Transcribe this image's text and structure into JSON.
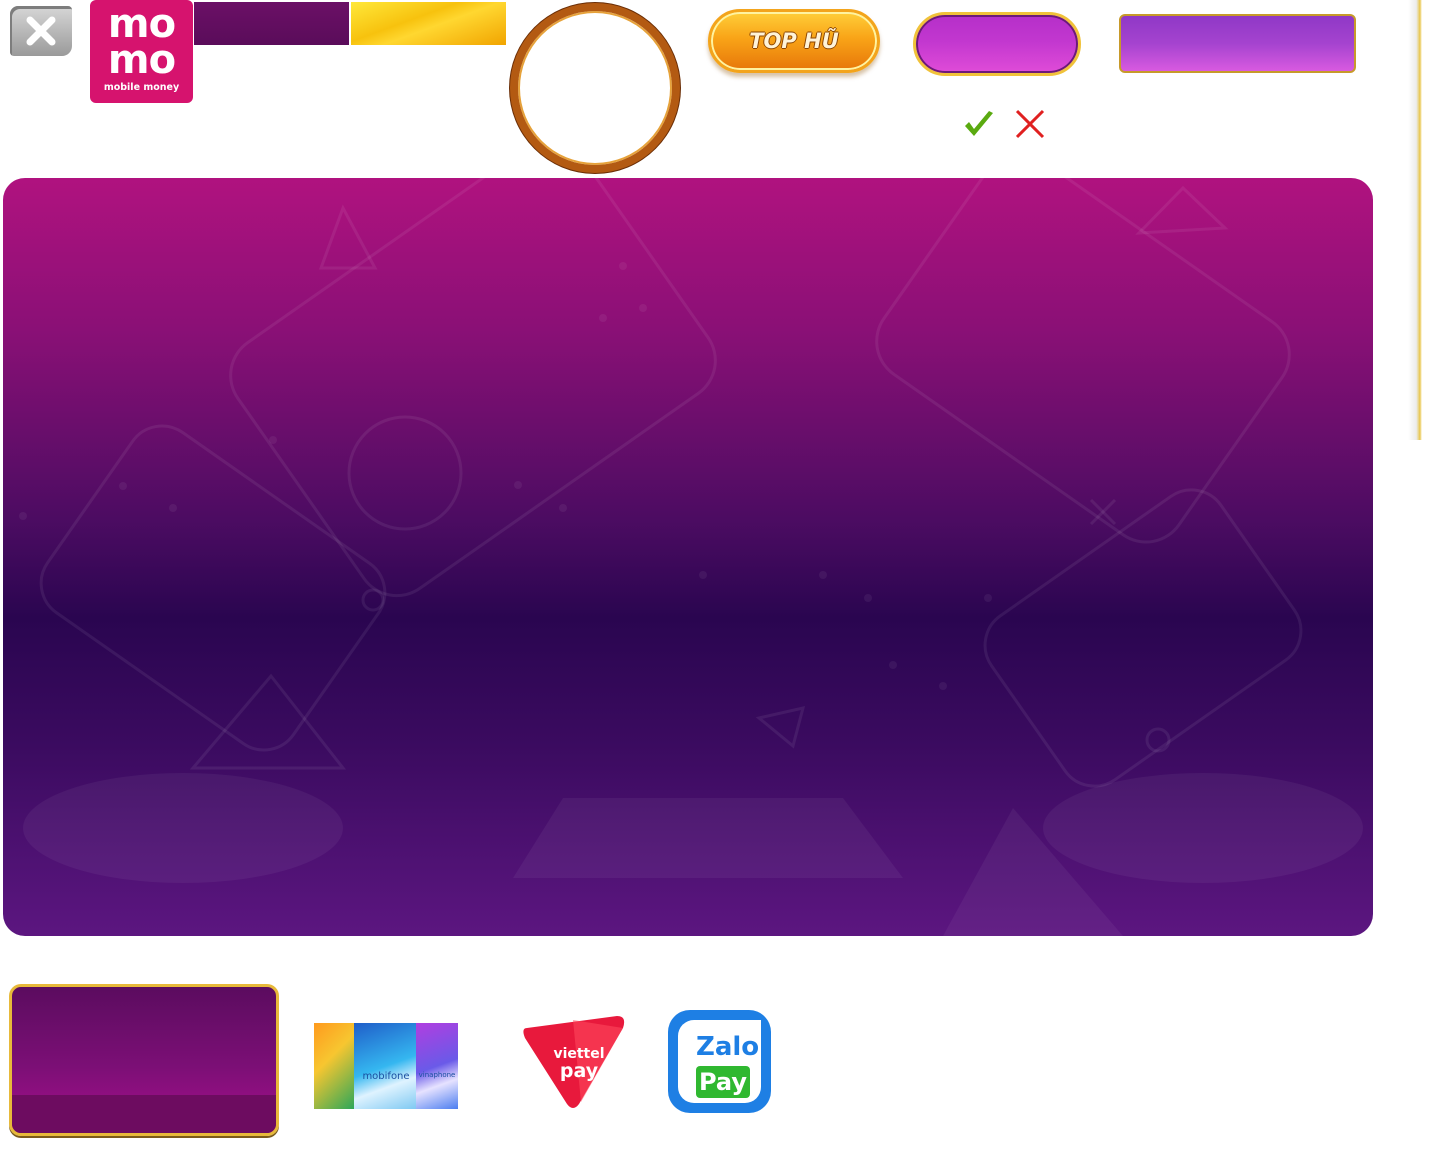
{
  "close_button": {
    "icon": "close-icon"
  },
  "momo_logo": {
    "line1": "mo",
    "line2": "mo",
    "subtitle": "mobile money",
    "color": "#d6136e"
  },
  "top_hu_button": {
    "label": "TOP HŨ"
  },
  "status_icons": {
    "confirm": "check-icon",
    "cancel": "x-icon",
    "confirm_color": "#5aaa10",
    "cancel_color": "#e02020"
  },
  "payment_methods": {
    "phone_cards": [
      {
        "name": "viettel",
        "label": ""
      },
      {
        "name": "mobifone",
        "label": "mobifone"
      },
      {
        "name": "vinaphone",
        "label": "vinaphone"
      }
    ],
    "viettelpay": {
      "line1": "viettel",
      "line2": "pay"
    },
    "zalopay": {
      "line1": "Zalo",
      "line2": "Pay"
    }
  },
  "colors": {
    "panel_top": "#b0127f",
    "panel_mid": "#2a0550",
    "gold_accent": "#e7b93a"
  }
}
